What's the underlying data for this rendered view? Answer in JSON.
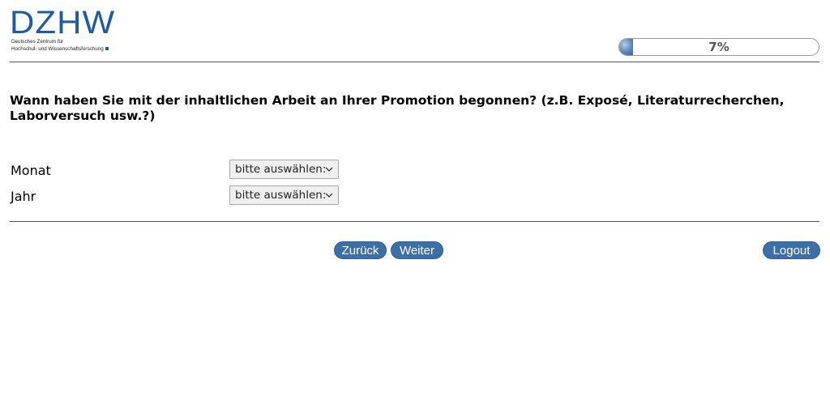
{
  "brand": {
    "logo_text": "DZHW",
    "logo_subtitle_line1": "Deutsches Zentrum für",
    "logo_subtitle_line2": "Hochschul- und Wissenschaftsforschung",
    "color": "#1f5aa6"
  },
  "progress": {
    "label": "7%",
    "fraction": 0.07
  },
  "question": {
    "text": "Wann haben Sie mit der inhaltlichen Arbeit an Ihrer Promotion begonnen? (z.B. Exposé, Literaturrecherchen, Laborversuch usw.?)"
  },
  "fields": {
    "month": {
      "label": "Monat",
      "selected": "bitte auswählen:"
    },
    "year": {
      "label": "Jahr",
      "selected": "bitte auswählen:"
    }
  },
  "nav": {
    "back_label": "Zurück",
    "next_label": "Weiter",
    "logout_label": "Logout",
    "button_color": "#3c6ea8"
  }
}
